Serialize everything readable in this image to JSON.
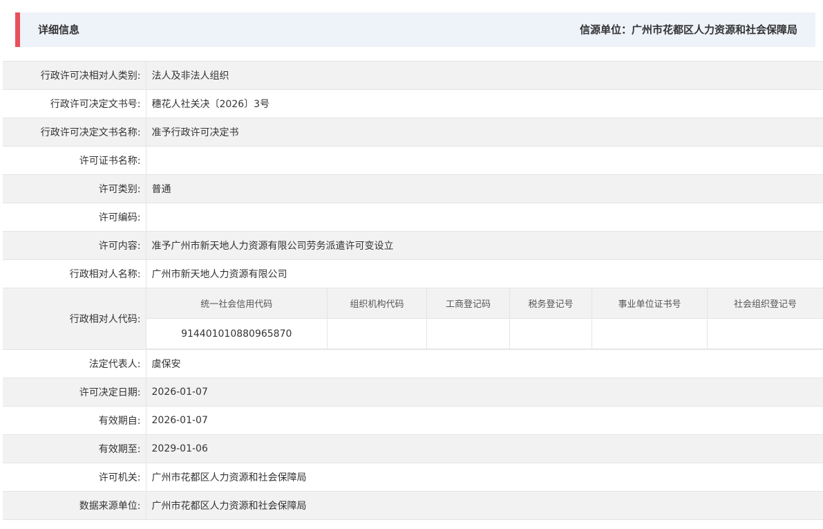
{
  "header": {
    "title": "详细信息",
    "source": "信源单位：广州市花都区人力资源和社会保障局",
    "accent_color": "#e8505b",
    "background_color": "#eef2f9"
  },
  "rows": [
    {
      "label": "行政许可决相对人类别:",
      "value": "法人及非法人组织"
    },
    {
      "label": "行政许可决定文书号:",
      "value": "穗花人社关决〔2026〕3号"
    },
    {
      "label": "行政许可决定文书名称:",
      "value": "准予行政许可决定书"
    },
    {
      "label": "许可证书名称:",
      "value": ""
    },
    {
      "label": "许可类别:",
      "value": "普通"
    },
    {
      "label": "许可编码:",
      "value": ""
    },
    {
      "label": "许可内容:",
      "value": "准予广州市新天地人力资源有限公司劳务派遣许可变设立"
    },
    {
      "label": "行政相对人名称:",
      "value": "广州市新天地人力资源有限公司"
    }
  ],
  "code_section": {
    "label": "行政相对人代码:",
    "headers": [
      "统一社会信用代码",
      "组织机构代码",
      "工商登记码",
      "税务登记号",
      "事业单位证书号",
      "社会组织登记号"
    ],
    "values": [
      "914401010880965870",
      "",
      "",
      "",
      "",
      ""
    ]
  },
  "rows_after": [
    {
      "label": "法定代表人:",
      "value": "虞保安"
    },
    {
      "label": "许可决定日期:",
      "value": "2026-01-07"
    },
    {
      "label": "有效期自:",
      "value": "2026-01-07"
    },
    {
      "label": "有效期至:",
      "value": "2029-01-06"
    },
    {
      "label": "许可机关:",
      "value": "广州市花都区人力资源和社会保障局"
    },
    {
      "label": "数据来源单位:",
      "value": "广州市花都区人力资源和社会保障局"
    }
  ]
}
